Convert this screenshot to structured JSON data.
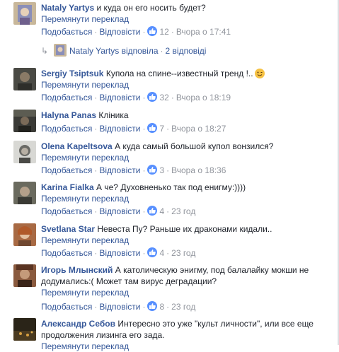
{
  "labels": {
    "see_translation": "Перемянути переклад",
    "like": "Подобається",
    "reply": "Відповісти",
    "dot": "·"
  },
  "comments": [
    {
      "author": "Nataly Yartys",
      "text": "и куда он его носить будет?",
      "likes": "12",
      "time": "Вчора о 17:41",
      "reply_summary": {
        "author": "Nataly Yartys",
        "verb": "відповіла",
        "count": "2 відповіді"
      }
    },
    {
      "author": "Sergiy Tsiptsuk",
      "text": "Купола на спине--известный тренд !..",
      "likes": "32",
      "time": "Вчора о 18:19"
    },
    {
      "author": "Halyna Panas",
      "text": "Кліника",
      "likes": "7",
      "time": "Вчора о 18:27"
    },
    {
      "author": "Olena Kapeltsova",
      "text": "А куда самый большой купол вонзился?",
      "likes": "3",
      "time": "Вчора о 18:36"
    },
    {
      "author": "Karina Fialka",
      "text": "А че? Духовненько так под енигму:))))",
      "likes": "4",
      "time": "23 год"
    },
    {
      "author": "Svetlana Star",
      "text": "Невеста Пу? Раньше их драконами кидали..",
      "likes": "4",
      "time": "23 год"
    },
    {
      "author": "Игорь Млынский",
      "text": "А католическую энигму, под балалайку мокши не додумались:( Может там вирус деградации?",
      "likes": "8",
      "time": "23 год"
    },
    {
      "author": "Александр Себов",
      "text": "Интересно это уже \"культ личности\", или все еще продолжения лизинга его зада."
    }
  ]
}
